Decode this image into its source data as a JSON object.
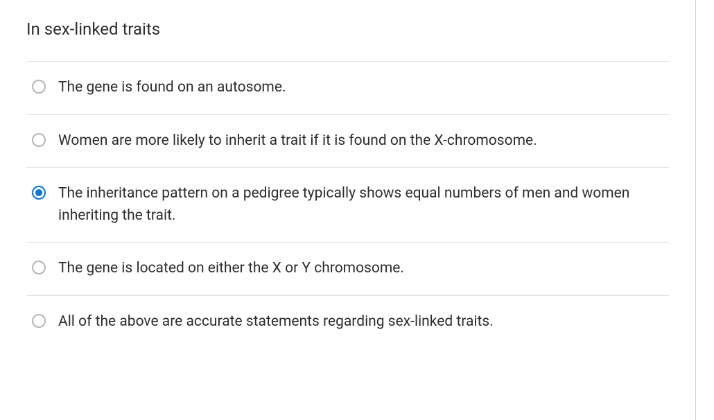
{
  "question": {
    "title": "In sex-linked traits",
    "options": [
      {
        "label": "The gene is found on an autosome.",
        "selected": false
      },
      {
        "label": "Women are more likely to inherit a trait if it is found on the X-chromosome.",
        "selected": false
      },
      {
        "label": "The inheritance pattern on a pedigree typically shows equal numbers of men and women inheriting the trait.",
        "selected": true
      },
      {
        "label": "The gene is located on either the X or Y chromosome.",
        "selected": false
      },
      {
        "label": "All of the above are accurate statements regarding sex-linked traits.",
        "selected": false
      }
    ]
  }
}
